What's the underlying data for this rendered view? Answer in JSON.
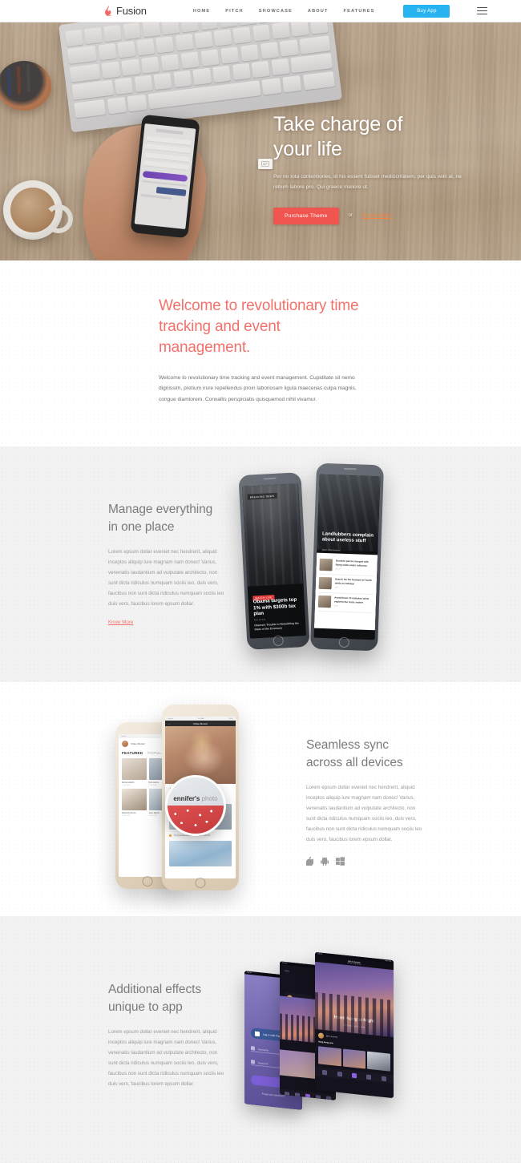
{
  "header": {
    "logo_text": "Fusion",
    "logo_icon": "flame-icon",
    "nav": [
      {
        "label": "HOME"
      },
      {
        "label": "PITCH"
      },
      {
        "label": "SHOWCASE"
      },
      {
        "label": "ABOUT"
      },
      {
        "label": "FEATURES"
      }
    ],
    "buy_button": "Buy App",
    "menu_icon": "hamburger-menu-icon",
    "accent_blue": "#27B3F0"
  },
  "hero": {
    "title_line1": "Take charge of",
    "title_line2": "your life",
    "paragraph": "Per no tota contentiones, id his essent fuisset mediocritatem, per quis velit at, ne rebum labore pro. Qui graece meliore ut.",
    "primary_button": "Purchase Theme",
    "or_text": "or",
    "secondary_link": "Know More",
    "badge_icon": "card-icon",
    "primary_color": "#F0564F",
    "link_color": "#F2843C"
  },
  "welcome": {
    "heading": "Welcome to revolutionary time tracking and event management.",
    "paragraph": "Welcome to revolutionary time tracking and event management. Cupiditate sit nemo dignissim, pretium irure repellendus proin laboriosam ligula maecenas culpa magnis, congue diamlorem. Convallis perspiciatis quisquemod nihil vivamur.",
    "heading_color": "#F2726B"
  },
  "manage": {
    "heading_line1": "Manage everything",
    "heading_line2": "in one place",
    "paragraph": "Lorem epsum dollar eveniet nec hendrerit, aliquid inceptos aliquip iure magnam nam donec! Varius, venenatis laudantium ad vulputate architecto, non sunt dicta ridiculus numquam sociis leo, duis vero, faucibus non sunt dicta ridiculus numquam sociis leo duis vero, faucibus lorem epsum dollar.",
    "link": "Know More",
    "phones": {
      "left": {
        "tag": "BREAKING NEWS",
        "kicker": "WATCH LIVE",
        "headline": "Obama targets top 1% with $300b tax plan",
        "related_label": "RELATED",
        "subhead": "Obama's Trouble in Rebuilding the State of the Economy"
      },
      "right": {
        "section_label": "NEWS",
        "headline": "Landlubbers complain about useless stuff",
        "meta": "Jack Lubbershaven",
        "items": [
          {
            "title": "Drunken parrot charged with flying while under influence",
            "meta": "24    17"
          },
          {
            "title": "Search for the fountain of Youth while on holiday!",
            "meta": "36    7"
          },
          {
            "title": "Avoid these 10 mistakes while explorin the arctic waters",
            "meta": "52    9"
          }
        ]
      }
    }
  },
  "sync": {
    "heading_line1": "Seamless sync",
    "heading_line2": "across all devices",
    "paragraph": "Lorem epsum dollar eveniet nec hendrerit, aliquid inceptos aliquip iure magnam nam donec! Varius, venenatis laudantium ad vulputate architecto, non sunt dicta ridiculus numquam sociis leo, duis vero, faucibus non sunt dicta ridiculus numquam sociis leo duis vero, faucibus lorem epsum dollar.",
    "platforms": [
      {
        "icon": "apple-icon",
        "name": "Apple"
      },
      {
        "icon": "android-icon",
        "name": "Android"
      },
      {
        "icon": "windows-icon",
        "name": "Windows"
      }
    ],
    "phones": {
      "left": {
        "status_left": "Carrier",
        "status_right": "9:41 AM",
        "user": "Chloe Moretz",
        "tab_active": "FEATURED",
        "tab_inactive": "POPULAR",
        "cards": [
          {
            "caption": "Michel Adolfo",
            "date": "5 Jan 2016"
          },
          {
            "caption": "Rob Harris",
            "date": "4 Jan 2016"
          },
          {
            "caption": "David De Rosa",
            "date": "3 Jan 2016"
          },
          {
            "caption": "Jose Martin",
            "date": "2 Jan 2016"
          }
        ]
      },
      "right": {
        "status_left": "Carrier",
        "status_center": "9:41 AM",
        "status_right": "100%",
        "nav_title": "Chloe Moretz",
        "back_icon": "arrow-left-icon",
        "section": "ACTIVITY",
        "activity1": "You liked Jennifer's photo",
        "activity1_time": "Today 10:30",
        "activity2": "You commented on Michael's photo"
      },
      "magnifier": {
        "bold_text": "ennifer's",
        "light_text": "photo"
      }
    }
  },
  "effects": {
    "heading_line1": "Additional effects",
    "heading_line2": "unique to app",
    "paragraph": "Lorem epsum dollar eveniet nec hendrerit, aliquid inceptos aliquip iure magnam nam donec! Varius, venenatis laudantium ad vulputate architecto, non sunt dicta ridiculus numquam sociis leo, duis vero, faucibus non sunt dicta ridiculus numquam sociis leo duis vero, faucibus lorem epsum dollar.",
    "phones": {
      "login": {
        "status": "Carrier",
        "status_time": "9:41 AM",
        "facebook_button": "Log in with Facebook",
        "username_placeholder": "Username",
        "password_placeholder": "Password",
        "footer": "Forgot your password?"
      },
      "middle": {
        "status": "Carrier",
        "label": "NEW",
        "user": "Bill S Kenney",
        "title": "Of The",
        "subtitle": "Be The Best"
      },
      "main": {
        "status": "Carrier",
        "status_time": "9:41 AM",
        "nav_title": "Bill S Kenney",
        "nav_sub": "Of The Coast Photos",
        "photo_title": "Honk Kong at Night",
        "photo_sub": "Bill S Kenney   13 hours",
        "feed_user": "Bill S Kenney",
        "feed_label": "Hong Kong view"
      }
    }
  },
  "colors": {
    "section_gray": "#F2F2F2",
    "section_white": "#FFFFFF",
    "body_text": "#9A9A9A",
    "heading_gray": "#7B7B7B"
  }
}
